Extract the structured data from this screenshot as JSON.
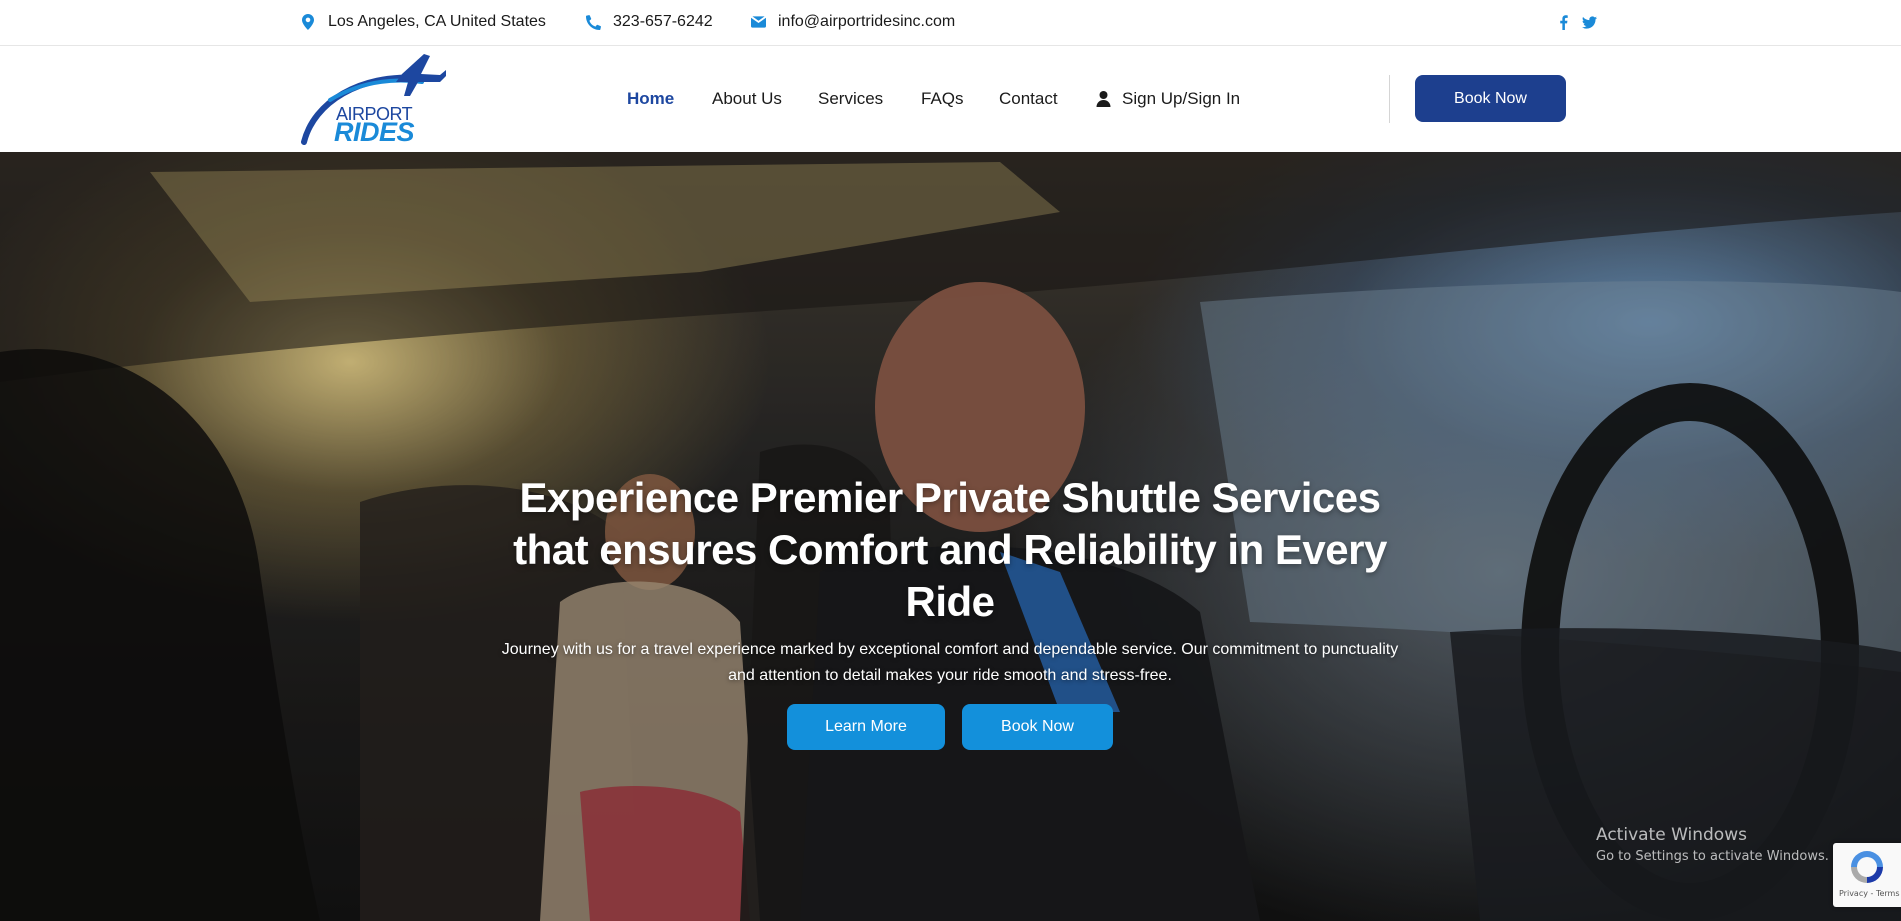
{
  "topbar": {
    "location": "Los Angeles, CA United States",
    "phone": "323-657-6242",
    "email": "info@airportridesinc.com",
    "social": [
      "facebook-icon",
      "twitter-icon"
    ]
  },
  "header": {
    "logo_line1": "AIRPORT",
    "logo_line2": "RIDES",
    "nav": {
      "home": "Home",
      "about": "About Us",
      "services": "Services",
      "faqs": "FAQs",
      "contact": "Contact",
      "sign": "Sign Up/Sign In"
    },
    "book_label": "Book Now"
  },
  "hero": {
    "title": "Experience Premier Private Shuttle Services that ensures Comfort and Reliability in Every Ride",
    "subtitle": "Journey with us for a travel experience marked by exceptional comfort and dependable service. Our commitment to punctuality and attention to detail makes your ride smooth and stress-free.",
    "learn_more": "Learn More",
    "book_now": "Book Now"
  },
  "overlay": {
    "activate_title": "Activate Windows",
    "activate_sub": "Go to Settings to activate Windows.",
    "recaptcha_label": "Privacy - Terms"
  },
  "colors": {
    "brand_navy": "#1d3f8e",
    "brand_blue": "#1390db",
    "icon_blue": "#1a8ad8"
  }
}
